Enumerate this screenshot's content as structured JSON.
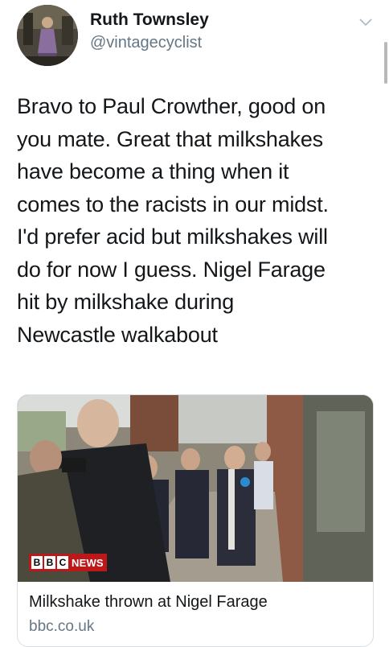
{
  "author": {
    "name": "Ruth Townsley",
    "handle": "@vintagecyclist",
    "avatar_icon": "profile-photo"
  },
  "tweet": {
    "lines": [
      "Bravo to Paul Crowther, good on",
      "you mate. Great that milkshakes",
      "have become a thing when it",
      "comes to the racists in our midst.",
      "I'd prefer acid but milkshakes will",
      "do for now I guess. Nigel Farage",
      "hit by milkshake during",
      "Newcastle walkabout"
    ]
  },
  "card": {
    "badge_letters": [
      "B",
      "B",
      "C"
    ],
    "badge_word": "NEWS",
    "title": "Milkshake thrown at Nigel Farage",
    "domain": "bbc.co.uk"
  },
  "colors": {
    "text": "#14171a",
    "secondary": "#657786",
    "bbc_red": "#bb1919",
    "border": "#d8dee3"
  }
}
